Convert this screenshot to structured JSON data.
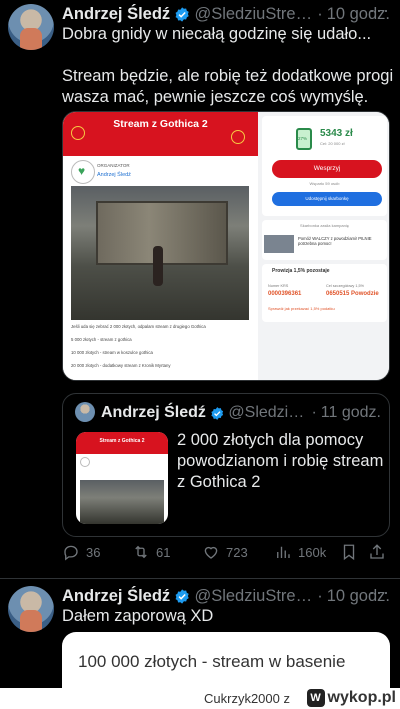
{
  "tweet1": {
    "author": "Andrzej Śledź",
    "handle": "@SledziuStream",
    "separator": "·",
    "time": "10 godz.",
    "more": "···",
    "line1": "Dobra gnidy w niecałą godzinę się udało...",
    "line2": "Stream będzie, ale robię też dodatkowe progi",
    "line3": "wasza mać, pewnie jeszcze coś wymyślę."
  },
  "screenshot": {
    "banner_title": "Stream z Gothica 2",
    "org_label": "ORGANIZATOR",
    "org_name": "Andrzej Śledź",
    "desc_lines": [
      "Jeśli uda się zebrać 2 000 złotych, odpalam stream z drugiego Gothica",
      "5 000 złotych - stream z gothica",
      "10 000 złotych - stream w koszulce gothica",
      "20 000 złotych - dodatkowy stream z Kronik Myrtany"
    ],
    "percent": "27%",
    "amount": "5343 zł",
    "amount_sub": "Cel: 20 000 zł",
    "donate_button": "Wesprzyj",
    "supporters": "Wsparło 59 osób",
    "share_button": "Udostępnij skarbonkę",
    "campaign_label": "Skarbonka zasila kampanię",
    "campaign_text": "Pomóż WALCZY z powodziami! PILNIE potrzebna pomoc!",
    "provision": "Prowizja 1,5% pozostaje",
    "krs_label": "Numer KRS",
    "krs_value": "0000396361",
    "purpose_label": "Cel szczegółowy 1,5%",
    "purpose_value": "0650515 Powodzie",
    "check_link": "Sprawdź jak przekazać 1,5% podatku"
  },
  "quote": {
    "author": "Andrzej Śledź",
    "handle": "@SledziuS...",
    "separator": "·",
    "time": "11 godz.",
    "thumb_title": "Stream z Gothica 2",
    "text": "2 000 złotych dla pomocy powodzianom i robię stream z Gothica 2"
  },
  "actions": {
    "replies": "36",
    "retweets": "61",
    "likes": "723",
    "views": "160k"
  },
  "tweet2": {
    "author": "Andrzej Śledź",
    "handle": "@SledziuStream",
    "separator": "·",
    "time": "10 godz.",
    "more": "···",
    "text": "Dałem zaporową XD",
    "card_text": "100 000 złotych - stream w basenie"
  },
  "footer": {
    "user": "Cukrzyk2000",
    "z": "z",
    "logo": "wykop.pl",
    "logo_badge": "W"
  },
  "colors": {
    "background": "#000000",
    "verified": "#1d9bf0",
    "brand_red": "#d7131f"
  }
}
